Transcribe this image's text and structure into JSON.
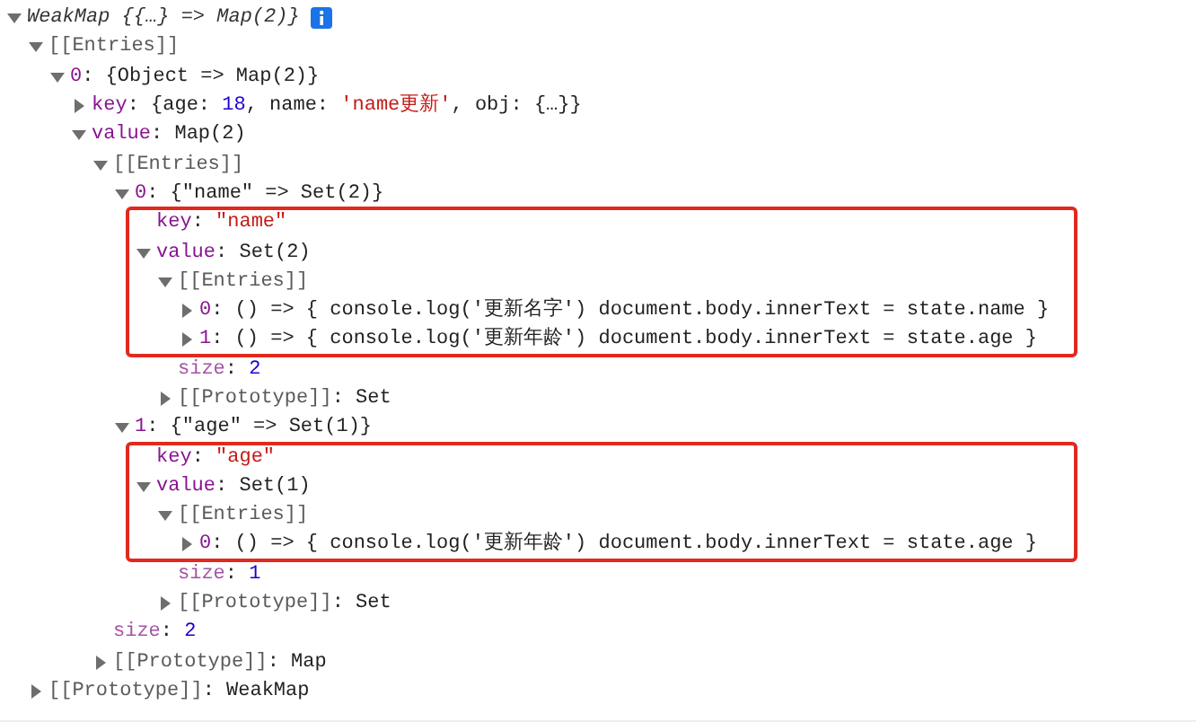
{
  "tree": [
    {
      "expanded": true,
      "info": true,
      "segments": [
        {
          "kind": "italic",
          "text": "WeakMap {{…} => Map(2)}"
        }
      ],
      "children": [
        {
          "expanded": true,
          "segments": [
            {
              "kind": "internal",
              "text": "[[Entries]]"
            }
          ],
          "children": [
            {
              "expanded": true,
              "segments": [
                {
                  "kind": "name",
                  "text": "0"
                },
                {
                  "kind": "punct",
                  "text": ": {Object => Map(2)}"
                }
              ],
              "children": [
                {
                  "expanded": false,
                  "segments": [
                    {
                      "kind": "name",
                      "text": "key"
                    },
                    {
                      "kind": "punct",
                      "text": ": {age: "
                    },
                    {
                      "kind": "number",
                      "text": "18"
                    },
                    {
                      "kind": "punct",
                      "text": ", name: "
                    },
                    {
                      "kind": "string",
                      "text": "'name更新'"
                    },
                    {
                      "kind": "punct",
                      "text": ", obj: {…}}"
                    }
                  ]
                },
                {
                  "expanded": true,
                  "segments": [
                    {
                      "kind": "name",
                      "text": "value"
                    },
                    {
                      "kind": "punct",
                      "text": ": Map(2)"
                    }
                  ],
                  "children": [
                    {
                      "expanded": true,
                      "segments": [
                        {
                          "kind": "internal",
                          "text": "[[Entries]]"
                        }
                      ],
                      "children": [
                        {
                          "expanded": true,
                          "segments": [
                            {
                              "kind": "name",
                              "text": "0"
                            },
                            {
                              "kind": "punct",
                              "text": ": {\"name\" => Set(2)}"
                            }
                          ],
                          "children": [
                            {
                              "boxed": true,
                              "segments": [
                                {
                                  "kind": "name",
                                  "text": "key"
                                },
                                {
                                  "kind": "punct",
                                  "text": ": "
                                },
                                {
                                  "kind": "string",
                                  "text": "\"name\""
                                }
                              ]
                            },
                            {
                              "boxed": true,
                              "expanded": true,
                              "segments": [
                                {
                                  "kind": "name",
                                  "text": "value"
                                },
                                {
                                  "kind": "punct",
                                  "text": ": Set(2)"
                                }
                              ],
                              "children": [
                                {
                                  "boxed": true,
                                  "expanded": true,
                                  "segments": [
                                    {
                                      "kind": "internal",
                                      "text": "[[Entries]]"
                                    }
                                  ],
                                  "children": [
                                    {
                                      "boxed": true,
                                      "expanded": false,
                                      "segments": [
                                        {
                                          "kind": "name",
                                          "text": "0"
                                        },
                                        {
                                          "kind": "punct",
                                          "text": ": () => { console.log('更新名字') document.body.innerText = state.name }"
                                        }
                                      ]
                                    },
                                    {
                                      "boxed": true,
                                      "expanded": false,
                                      "segments": [
                                        {
                                          "kind": "name",
                                          "text": "1"
                                        },
                                        {
                                          "kind": "punct",
                                          "text": ": () => { console.log('更新年龄') document.body.innerText = state.age }"
                                        }
                                      ]
                                    }
                                  ]
                                },
                                {
                                  "boxed": false,
                                  "segments": [
                                    {
                                      "kind": "meta",
                                      "text": "size"
                                    },
                                    {
                                      "kind": "punct",
                                      "text": ": "
                                    },
                                    {
                                      "kind": "number",
                                      "text": "2"
                                    }
                                  ]
                                },
                                {
                                  "boxed": false,
                                  "expanded": false,
                                  "segments": [
                                    {
                                      "kind": "internal",
                                      "text": "[[Prototype]]"
                                    },
                                    {
                                      "kind": "punct",
                                      "text": ": Set"
                                    }
                                  ]
                                }
                              ]
                            }
                          ]
                        },
                        {
                          "expanded": true,
                          "segments": [
                            {
                              "kind": "name",
                              "text": "1"
                            },
                            {
                              "kind": "punct",
                              "text": ": {\"age\" => Set(1)}"
                            }
                          ],
                          "children": [
                            {
                              "boxed": true,
                              "segments": [
                                {
                                  "kind": "name",
                                  "text": "key"
                                },
                                {
                                  "kind": "punct",
                                  "text": ": "
                                },
                                {
                                  "kind": "string",
                                  "text": "\"age\""
                                }
                              ]
                            },
                            {
                              "boxed": true,
                              "expanded": true,
                              "segments": [
                                {
                                  "kind": "name",
                                  "text": "value"
                                },
                                {
                                  "kind": "punct",
                                  "text": ": Set(1)"
                                }
                              ],
                              "children": [
                                {
                                  "boxed": true,
                                  "expanded": true,
                                  "segments": [
                                    {
                                      "kind": "internal",
                                      "text": "[[Entries]]"
                                    }
                                  ],
                                  "children": [
                                    {
                                      "boxed": true,
                                      "expanded": false,
                                      "segments": [
                                        {
                                          "kind": "name",
                                          "text": "0"
                                        },
                                        {
                                          "kind": "punct",
                                          "text": ": () => { console.log('更新年龄') document.body.innerText = state.age }"
                                        }
                                      ]
                                    }
                                  ]
                                },
                                {
                                  "boxed": false,
                                  "segments": [
                                    {
                                      "kind": "meta",
                                      "text": "size"
                                    },
                                    {
                                      "kind": "punct",
                                      "text": ": "
                                    },
                                    {
                                      "kind": "number",
                                      "text": "1"
                                    }
                                  ]
                                },
                                {
                                  "boxed": false,
                                  "expanded": false,
                                  "segments": [
                                    {
                                      "kind": "internal",
                                      "text": "[[Prototype]]"
                                    },
                                    {
                                      "kind": "punct",
                                      "text": ": Set"
                                    }
                                  ]
                                }
                              ]
                            }
                          ]
                        }
                      ]
                    },
                    {
                      "segments": [
                        {
                          "kind": "meta",
                          "text": "size"
                        },
                        {
                          "kind": "punct",
                          "text": ": "
                        },
                        {
                          "kind": "number",
                          "text": "2"
                        }
                      ]
                    },
                    {
                      "expanded": false,
                      "segments": [
                        {
                          "kind": "internal",
                          "text": "[[Prototype]]"
                        },
                        {
                          "kind": "punct",
                          "text": ": Map"
                        }
                      ]
                    }
                  ]
                }
              ]
            }
          ]
        },
        {
          "expanded": false,
          "segments": [
            {
              "kind": "internal",
              "text": "[[Prototype]]"
            },
            {
              "kind": "punct",
              "text": ": WeakMap"
            }
          ]
        }
      ]
    }
  ]
}
